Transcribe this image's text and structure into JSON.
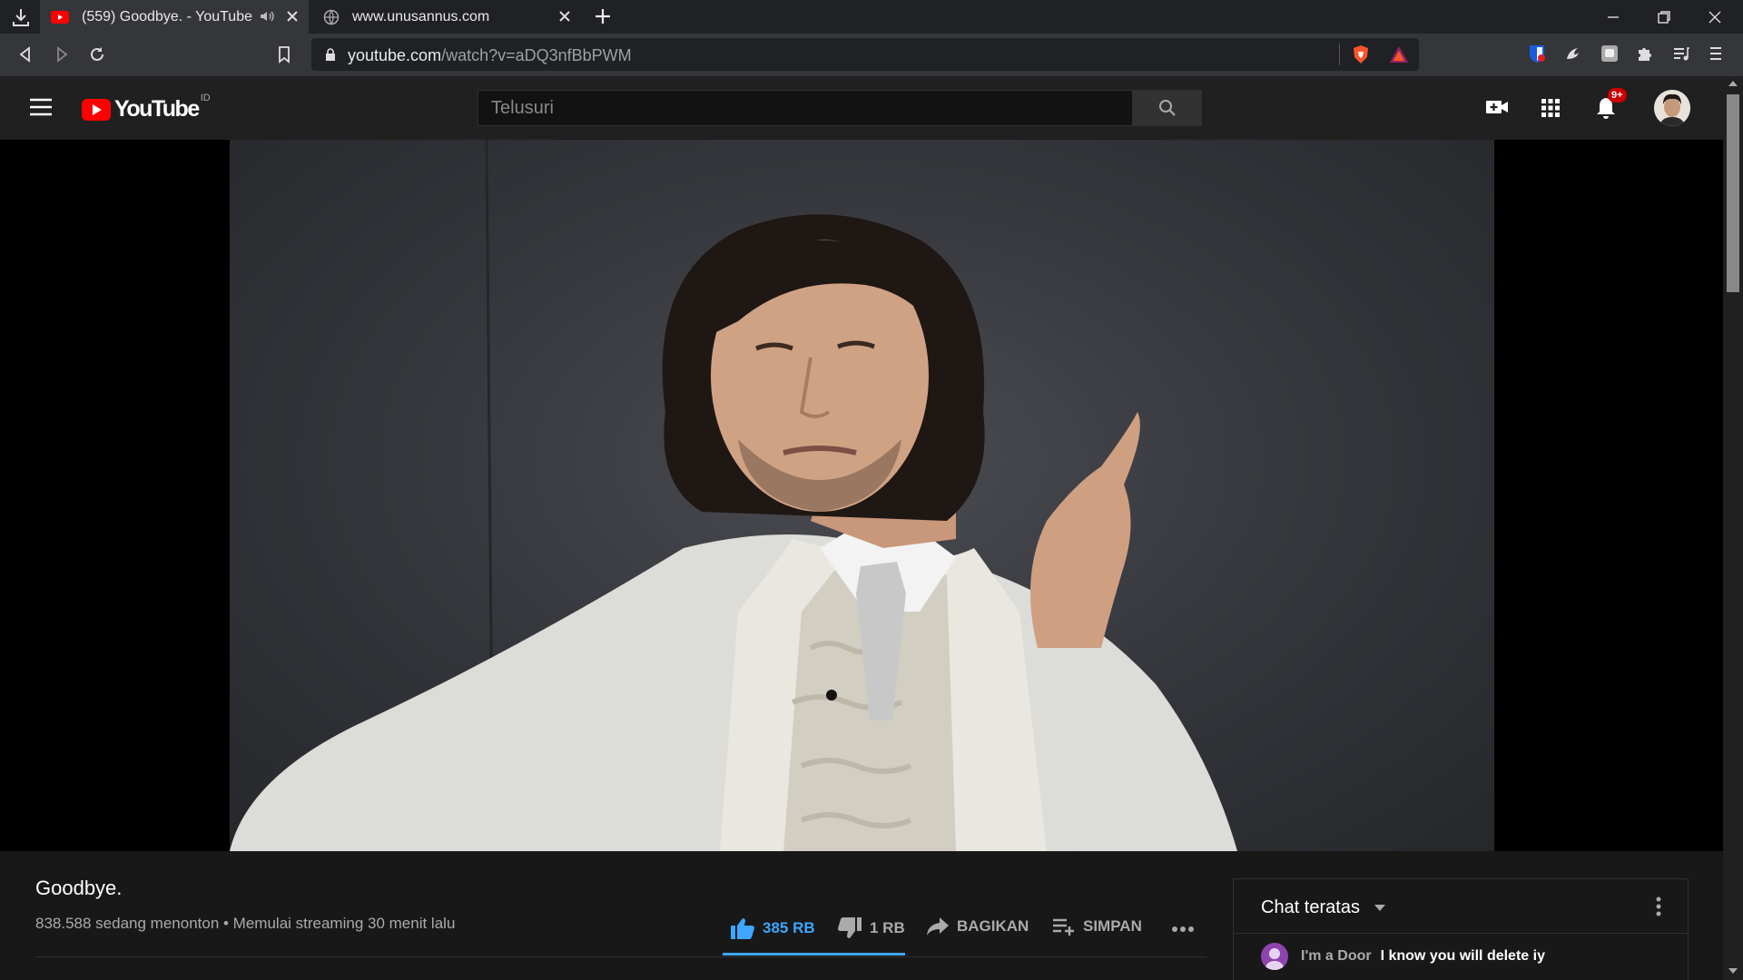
{
  "browser": {
    "tabs": [
      {
        "title": "(559) Goodbye. - YouTube",
        "active": true,
        "muted_icon": "speaker-icon"
      },
      {
        "title": "www.unusannus.com",
        "active": false
      }
    ],
    "address": {
      "host": "youtube.com",
      "path": "/watch?v=aDQ3nfBbPWM"
    }
  },
  "youtube": {
    "logo_text": "YouTube",
    "region": "ID",
    "search_placeholder": "Telusuri",
    "notifications": "9+"
  },
  "video": {
    "title": "Goodbye.",
    "meta": "838.588 sedang menonton • Memulai streaming 30 menit lalu",
    "likes": "385 RB",
    "dislikes": "1 RB",
    "share": "BAGIKAN",
    "save": "SIMPAN"
  },
  "chat": {
    "header": "Chat teratas",
    "messages": [
      {
        "author": "I'm a Door",
        "text": "I know you will delete iy"
      }
    ]
  },
  "colors": {
    "accent_blue": "#3ea6ff",
    "youtube_red": "#ff0000",
    "badge_red": "#cc0000"
  }
}
